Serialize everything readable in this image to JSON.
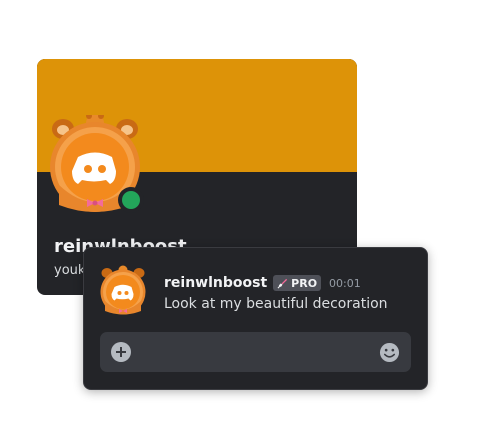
{
  "profile": {
    "display_name": "reinwlnboost",
    "sub_name": "youk",
    "banner_color": "#dd9308",
    "status": "online"
  },
  "message": {
    "author": "reinwlnboost",
    "badge": "PRO",
    "badge_icon": "rocket-icon",
    "timestamp": "00:01",
    "text": "Look at my beautiful decoration"
  },
  "input": {
    "left_icon": "plus-circle-icon",
    "right_icon": "emoji-icon"
  },
  "colors": {
    "discord_blurple": "#ffffff",
    "decoration_orange": "#f38a1d",
    "card_bg": "#232428",
    "status_online": "#23a55a"
  }
}
